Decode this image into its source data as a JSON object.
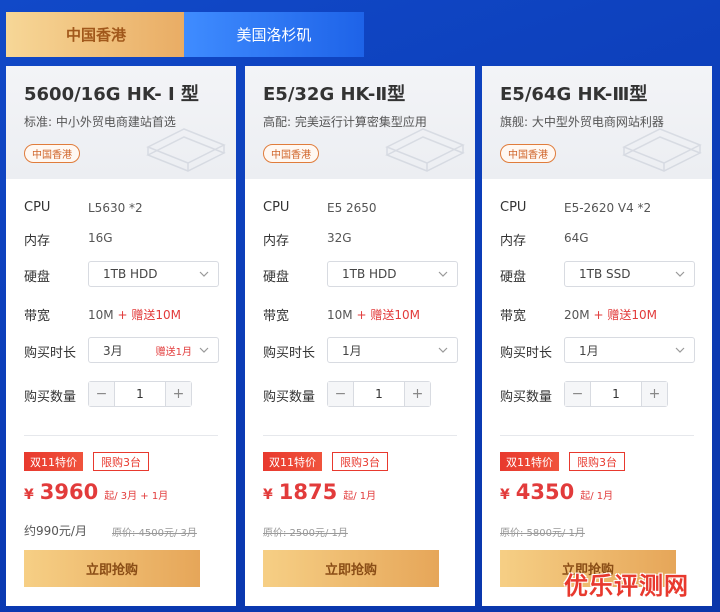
{
  "tabs": [
    {
      "label": "中国香港",
      "active": true
    },
    {
      "label": "美国洛杉矶",
      "active": false
    }
  ],
  "row_labels": {
    "cpu": "CPU",
    "memory": "内存",
    "disk": "硬盘",
    "bandwidth": "带宽",
    "duration": "购买时长",
    "quantity": "购买数量"
  },
  "buy_label": "立即抢购",
  "promo_label": "双11特价",
  "cards": [
    {
      "title": "5600/16G HK- Ⅰ 型",
      "subtitle": "标准: 中小外贸电商建站首选",
      "region": "中国香港",
      "cpu": "L5630 *2",
      "memory": "16G",
      "disk": "1TB HDD",
      "bandwidth_base": "10M",
      "bandwidth_bonus": "+ 赠送10M",
      "duration": "3月",
      "duration_note": "赠送1月",
      "quantity": "1",
      "limit": "限购3台",
      "price_symbol": "¥",
      "price": "3960",
      "price_unit": "起/ 3月 + 1月",
      "monthly": "约990元/月",
      "original_price": "原价: 4500元/ 3月"
    },
    {
      "title": "E5/32G HK-Ⅱ型",
      "subtitle": "高配: 完美运行计算密集型应用",
      "region": "中国香港",
      "cpu": "E5 2650",
      "memory": "32G",
      "disk": "1TB HDD",
      "bandwidth_base": "10M",
      "bandwidth_bonus": "+ 赠送10M",
      "duration": "1月",
      "duration_note": "",
      "quantity": "1",
      "limit": "限购3台",
      "price_symbol": "¥",
      "price": "1875",
      "price_unit": "起/ 1月",
      "monthly": "",
      "original_price": "原价: 2500元/ 1月"
    },
    {
      "title": "E5/64G HK-Ⅲ型",
      "subtitle": "旗舰: 大中型外贸电商网站利器",
      "region": "中国香港",
      "cpu": "E5-2620 V4 *2",
      "memory": "64G",
      "disk": "1TB SSD",
      "bandwidth_base": "20M",
      "bandwidth_bonus": "+ 赠送10M",
      "duration": "1月",
      "duration_note": "",
      "quantity": "1",
      "limit": "限购3台",
      "price_symbol": "¥",
      "price": "4350",
      "price_unit": "起/ 1月",
      "monthly": "",
      "original_price": "原价: 5800元/ 1月"
    }
  ],
  "watermark": "优乐评测网",
  "colors": {
    "background": "#0b3bb5",
    "accent_gold": "#e9ac64",
    "accent_red": "#e23b3b",
    "tab_blue": "#1e63e8"
  }
}
